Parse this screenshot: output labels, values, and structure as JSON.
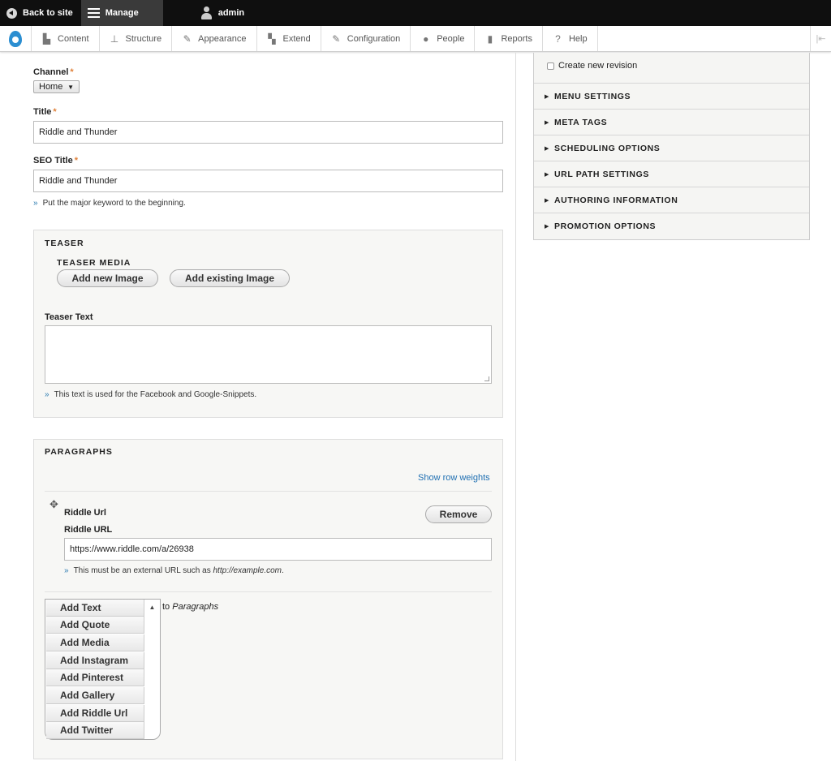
{
  "toolbar": {
    "back_to_site": "Back to site",
    "manage": "Manage",
    "user": "admin"
  },
  "tray": {
    "items": [
      {
        "label": "Content",
        "icon": "content-icon"
      },
      {
        "label": "Structure",
        "icon": "structure-icon"
      },
      {
        "label": "Appearance",
        "icon": "appearance-icon"
      },
      {
        "label": "Extend",
        "icon": "extend-icon"
      },
      {
        "label": "Configuration",
        "icon": "configuration-icon"
      },
      {
        "label": "People",
        "icon": "people-icon"
      },
      {
        "label": "Reports",
        "icon": "reports-icon"
      },
      {
        "label": "Help",
        "icon": "help-icon"
      }
    ]
  },
  "form": {
    "channel_label": "Channel",
    "channel_value": "Home",
    "title_label": "Title",
    "title_value": "Riddle and Thunder",
    "seo_title_label": "SEO Title",
    "seo_title_value": "Riddle and Thunder",
    "seo_title_desc": "Put the major keyword to the beginning."
  },
  "teaser": {
    "legend": "TEASER",
    "media_label": "TEASER MEDIA",
    "add_new_image": "Add new Image",
    "add_existing_image": "Add existing Image",
    "text_label": "Teaser Text",
    "text_value": "",
    "text_desc": "This text is used for the Facebook and Google-Snippets."
  },
  "paragraphs": {
    "legend": "PARAGRAPHS",
    "show_row_weights": "Show row weights",
    "item_type": "Riddle Url",
    "remove": "Remove",
    "url_label": "Riddle URL",
    "url_value": "https://www.riddle.com/a/26938",
    "url_desc_prefix": "This must be an external URL such as ",
    "url_desc_example": "http://example.com",
    "url_desc_suffix": ".",
    "add_to_prefix": "to ",
    "add_to_target": "Paragraphs",
    "add_buttons": [
      "Add Text",
      "Add Quote",
      "Add Media",
      "Add Instagram",
      "Add Pinterest",
      "Add Gallery",
      "Add Riddle Url",
      "Add Twitter"
    ]
  },
  "sidebar": {
    "create_revision": "Create new revision",
    "sections": [
      "MENU SETTINGS",
      "META TAGS",
      "SCHEDULING OPTIONS",
      "URL PATH SETTINGS",
      "AUTHORING INFORMATION",
      "PROMOTION OPTIONS"
    ]
  }
}
